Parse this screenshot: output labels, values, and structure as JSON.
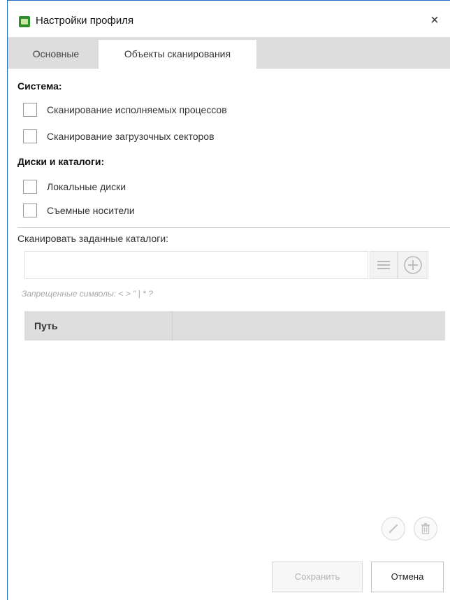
{
  "window": {
    "title": "Настройки профиля",
    "close_glyph": "×"
  },
  "tabs": [
    {
      "label": "Основные",
      "active": false
    },
    {
      "label": "Объекты сканирования",
      "active": true
    }
  ],
  "system": {
    "title": "Система:",
    "items": [
      {
        "label": "Сканирование исполняемых процессов",
        "checked": false
      },
      {
        "label": "Сканирование загрузочных секторов",
        "checked": false
      }
    ]
  },
  "disks": {
    "title": "Диски и каталоги:",
    "items": [
      {
        "label": "Локальные диски",
        "checked": false
      },
      {
        "label": "Съемные носители",
        "checked": false
      }
    ]
  },
  "scan_dirs": {
    "label": "Сканировать заданные каталоги:",
    "input_value": "",
    "hint": "Запрещенные символы: < > \" | * ?"
  },
  "table": {
    "columns": [
      "Путь",
      ""
    ],
    "rows": []
  },
  "icons": {
    "list": "list-icon",
    "add": "plus-circle-icon",
    "edit": "pencil-icon",
    "delete": "trash-icon"
  },
  "colors": {
    "window_border": "#1e6fbf",
    "tab_bar": "#dddddd",
    "table_header": "#dedede",
    "app_icon": "#2f8f2f"
  },
  "buttons": {
    "save": "Сохранить",
    "cancel": "Отмена"
  }
}
